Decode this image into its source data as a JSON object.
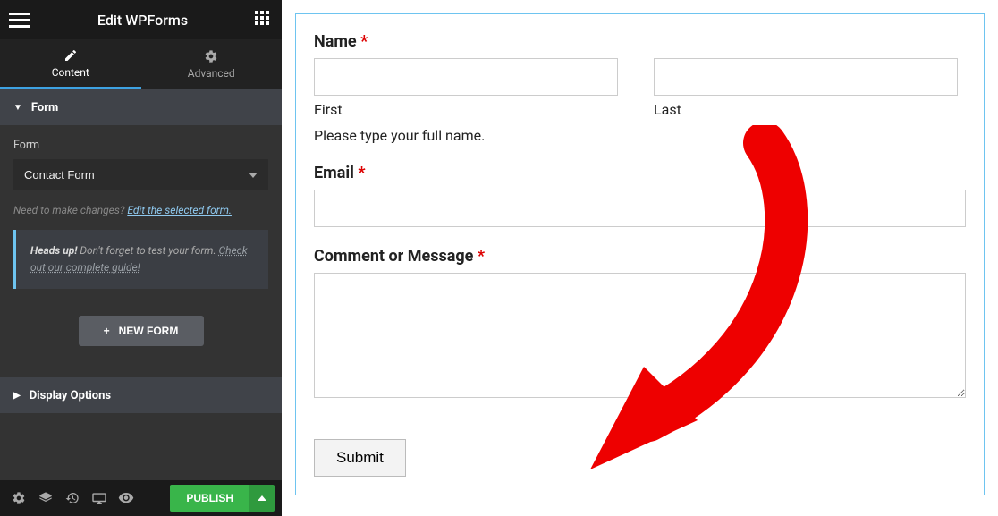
{
  "header": {
    "title": "Edit WPForms"
  },
  "tabs": {
    "content": "Content",
    "advanced": "Advanced"
  },
  "panels": {
    "form": {
      "title": "Form",
      "label": "Form",
      "selected": "Contact Form",
      "hint_prefix": "Need to make changes? ",
      "hint_link": "Edit the selected form.",
      "alert_bold": "Heads up!",
      "alert_text": " Don't forget to test your form. ",
      "alert_link": "Check out our complete guide!",
      "new_form_btn": "NEW FORM"
    },
    "display": {
      "title": "Display Options"
    }
  },
  "footer": {
    "publish": "PUBLISH"
  },
  "formPreview": {
    "name": {
      "label": "Name ",
      "first": "First",
      "last": "Last",
      "desc": "Please type your full name."
    },
    "email": {
      "label": "Email "
    },
    "comment": {
      "label": "Comment or Message "
    },
    "submit": "Submit"
  }
}
